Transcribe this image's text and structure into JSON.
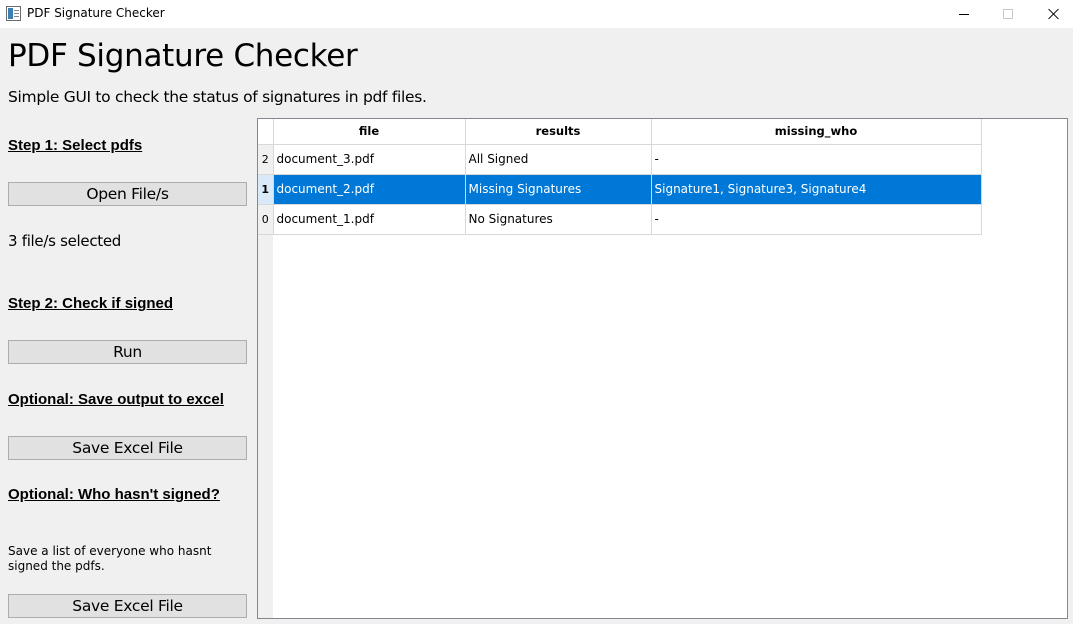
{
  "window": {
    "title": "PDF Signature Checker"
  },
  "app": {
    "heading": "PDF Signature Checker",
    "subtitle": "Simple GUI to check the status of signatures in pdf files."
  },
  "left_panel": {
    "step1_heading": "Step 1: Select pdfs",
    "open_button_label": "Open File/s",
    "files_selected_text": "3 file/s selected",
    "step2_heading": "Step 2: Check if signed",
    "run_button_label": "Run",
    "optional_save_heading": "Optional: Save output to excel",
    "save_excel_button_label": "Save Excel File",
    "optional_who_heading": "Optional: Who hasn't signed?",
    "who_description": "Save a list of everyone who hasnt signed the pdfs.",
    "save_who_button_label": "Save Excel File"
  },
  "table": {
    "columns": [
      "file",
      "results",
      "missing_who"
    ],
    "rows": [
      {
        "index": "2",
        "file": "document_3.pdf",
        "results": "All Signed",
        "missing_who": "-"
      },
      {
        "index": "1",
        "file": "document_2.pdf",
        "results": "Missing Signatures",
        "missing_who": "Signature1, Signature3, Signature4",
        "selected": true
      },
      {
        "index": "0",
        "file": "document_1.pdf",
        "results": "No Signatures",
        "missing_who": "-"
      }
    ]
  },
  "colors": {
    "selection": "#0078d7",
    "window_bg": "#f0f0f0",
    "button_bg": "#e1e1e1"
  }
}
